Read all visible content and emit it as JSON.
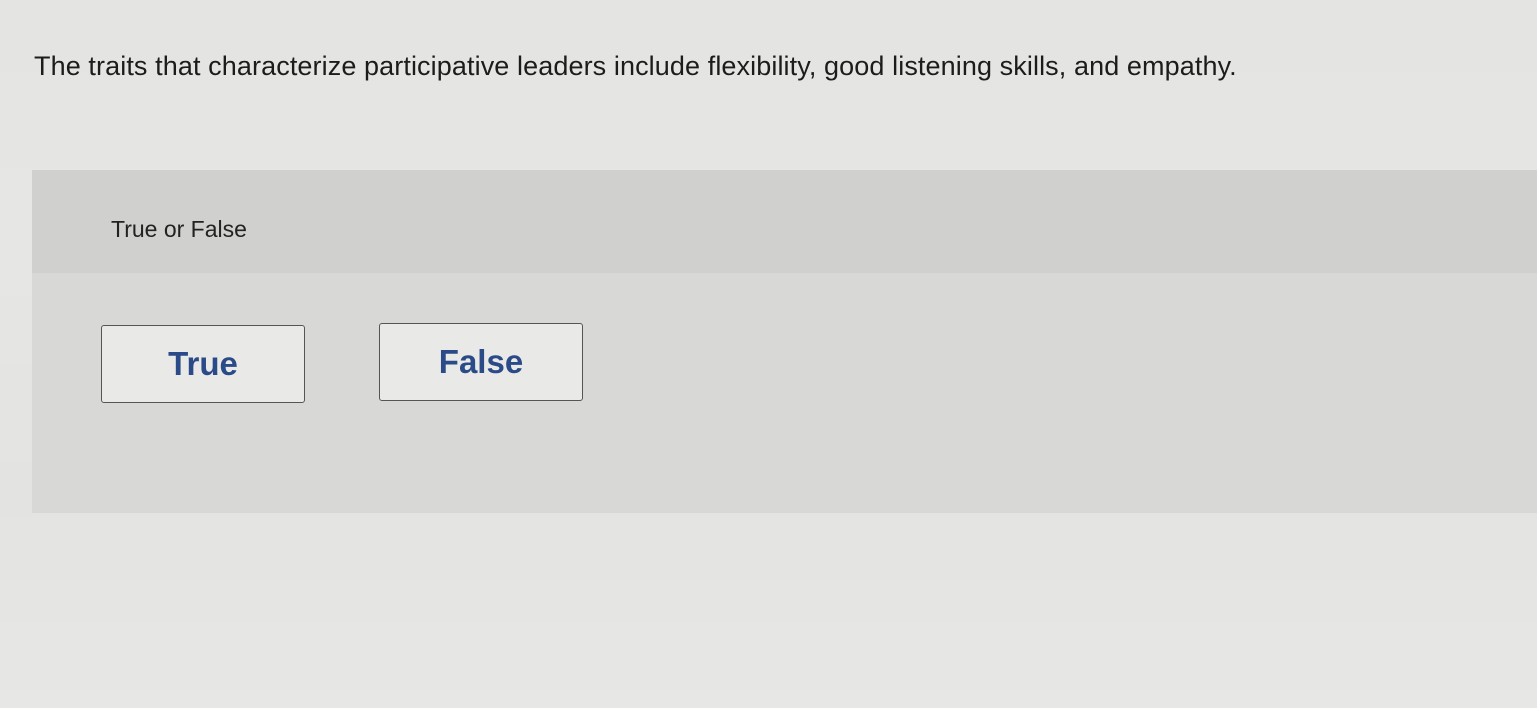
{
  "question": {
    "text": "The traits that characterize participative leaders include flexibility, good listening skills, and empathy."
  },
  "answer_panel": {
    "prompt": "True or False",
    "choices": [
      {
        "label": "True"
      },
      {
        "label": "False"
      }
    ]
  },
  "colors": {
    "choice_text": "#2a4a88",
    "panel_background": "#d8d8d6",
    "page_background": "#e5e5e3"
  }
}
